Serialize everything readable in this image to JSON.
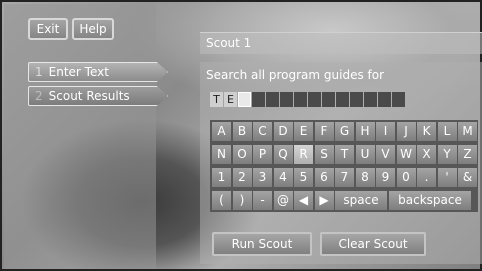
{
  "top_buttons": {
    "exit": "Exit",
    "help": "Help"
  },
  "nav": [
    {
      "num": "1",
      "label": "Enter Text"
    },
    {
      "num": "2",
      "label": "Scout Results"
    }
  ],
  "title": "Scout 1",
  "prompt": "Search all program guides for",
  "entry": {
    "chars": [
      "T",
      "E"
    ],
    "cell_count": 14
  },
  "keyboard": {
    "rows": [
      [
        "A",
        "B",
        "C",
        "D",
        "E",
        "F",
        "G",
        "H",
        "I",
        "J",
        "K",
        "L",
        "M"
      ],
      [
        "N",
        "O",
        "P",
        "Q",
        "R",
        "S",
        "T",
        "U",
        "V",
        "W",
        "X",
        "Y",
        "Z"
      ],
      [
        "1",
        "2",
        "3",
        "4",
        "5",
        "6",
        "7",
        "8",
        "9",
        "0",
        ".",
        "'",
        "&"
      ],
      [
        "(",
        ")",
        "-",
        "@",
        "◀",
        "▶",
        "space",
        "backspace"
      ]
    ],
    "selected": "R"
  },
  "actions": {
    "run": "Run Scout",
    "clear": "Clear Scout"
  }
}
